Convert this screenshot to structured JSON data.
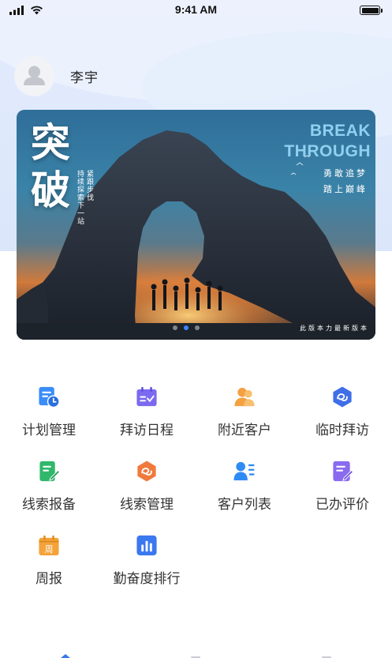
{
  "status_bar": {
    "time": "9:41 AM",
    "signal_icon": "signal-bars-icon",
    "wifi_icon": "wifi-icon",
    "battery_icon": "battery-icon"
  },
  "user": {
    "name": "李宇",
    "avatar_icon": "user-avatar-icon"
  },
  "banner": {
    "title_cn": "突破",
    "vertical_text": [
      "紧跟步伐",
      "持续探索下一站"
    ],
    "title_en": [
      "BREAK",
      "THROUGH"
    ],
    "slogan": [
      "勇敢追梦",
      "踏上巅峰"
    ],
    "footer": "此版本力最新版本",
    "page_count": 3,
    "active_page": 2
  },
  "menu": {
    "items": [
      {
        "label": "计划管理",
        "icon": "plan-calendar-clock-icon",
        "color": "#3a8dfb"
      },
      {
        "label": "拜访日程",
        "icon": "visit-schedule-icon",
        "color": "#7b69f0"
      },
      {
        "label": "附近客户",
        "icon": "nearby-customer-icon",
        "color": "#f4a142"
      },
      {
        "label": "临时拜访",
        "icon": "temporary-visit-icon",
        "color": "#3f6ee8"
      },
      {
        "label": "线索报备",
        "icon": "lead-report-icon",
        "color": "#2fb86b"
      },
      {
        "label": "线索管理",
        "icon": "lead-management-icon",
        "color": "#f07a3c"
      },
      {
        "label": "客户列表",
        "icon": "customer-list-icon",
        "color": "#2f8bf4"
      },
      {
        "label": "已办评价",
        "icon": "completed-review-icon",
        "color": "#8a6bf0"
      },
      {
        "label": "周报",
        "icon": "weekly-report-icon",
        "color": "#f4a33b"
      },
      {
        "label": "勤奋度排行",
        "icon": "diligence-ranking-icon",
        "color": "#3a78f0"
      }
    ],
    "weekly_badge": "周"
  },
  "tabbar": {
    "icons": [
      "home-tab-icon",
      "calendar-tab-icon",
      "profile-tab-icon"
    ]
  }
}
